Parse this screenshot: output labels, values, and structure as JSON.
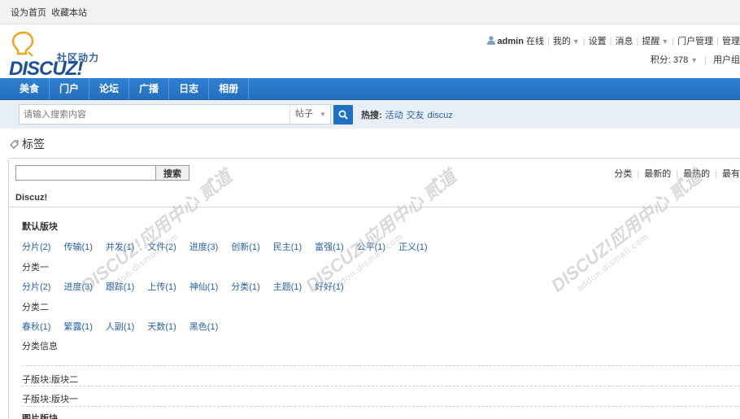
{
  "topbar": {
    "set_home": "设为首页",
    "bookmark": "收藏本站"
  },
  "logo": {
    "cn": "社区动力",
    "en": "DISCUZ!"
  },
  "userbar": {
    "username": "admin",
    "online": "在线",
    "mine": "我的",
    "settings": "设置",
    "messages": "消息",
    "reminders": "提醒",
    "portal_admin": "门户管理",
    "manage": "管理",
    "points": "积分: 378",
    "user_group": "用户组"
  },
  "nav": {
    "items": [
      "美食",
      "门户",
      "论坛",
      "广播",
      "日志",
      "相册"
    ]
  },
  "search": {
    "placeholder": "请输入搜索内容",
    "type": "帖子",
    "hot_label": "热搜:",
    "hot": [
      "活动",
      "交友",
      "discuz"
    ]
  },
  "page": {
    "title": "标签",
    "search_button": "搜索",
    "sort": [
      "分类",
      "最新的",
      "最热的",
      "最有"
    ]
  },
  "forum": {
    "name": "Discuz!"
  },
  "blocks": {
    "default_title": "默认版块",
    "default_tags": [
      "分片(2)",
      "传输(1)",
      "并发(1)",
      "文件(2)",
      "进度(3)",
      "创新(1)",
      "民主(1)",
      "富强(1)",
      "公平(1)",
      "正义(1)"
    ],
    "cat1_label": "分类一",
    "cat1_tags": [
      "分片(2)",
      "进度(3)",
      "跟踪(1)",
      "上传(1)",
      "神仙(1)",
      "分类(1)",
      "主题(1)",
      "好好(1)"
    ],
    "cat2_label": "分类二",
    "cat2_tags": [
      "春秋(1)",
      "繁露(1)",
      "人副(1)",
      "天数(1)",
      "黑色(1)"
    ],
    "cat_info_label": "分类信息",
    "sub1": "子版块:版块二",
    "sub2": "子版块:版块一",
    "picture_title": "图片版块"
  },
  "watermark": {
    "main": "DISCUZ!应用中心",
    "brand": "贰道",
    "url": "addon.dismall.com"
  }
}
